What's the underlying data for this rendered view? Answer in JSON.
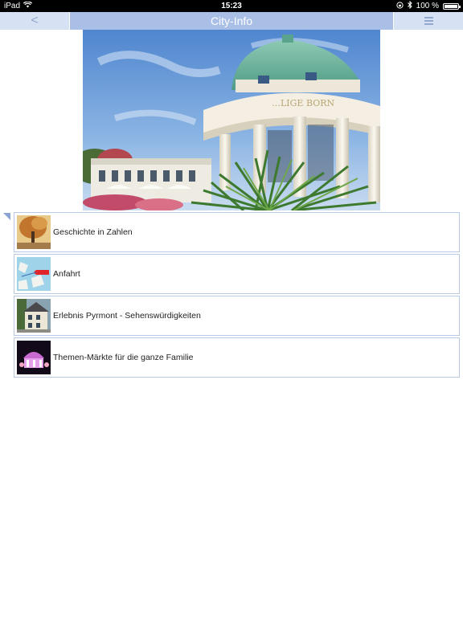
{
  "status_bar": {
    "device": "iPad",
    "time": "15:23",
    "battery": "100 %"
  },
  "nav": {
    "back_label": "<",
    "title": "City-Info"
  },
  "hero": {
    "sign_text": "…LIGE BORN"
  },
  "list": {
    "items": [
      {
        "label": "Geschichte in Zahlen"
      },
      {
        "label": "Anfahrt"
      },
      {
        "label": "Erlebnis Pyrmont - Sehenswürdigkeiten"
      },
      {
        "label": "Themen-Märkte für die ganze Familie"
      }
    ]
  },
  "colors": {
    "nav_title_bg": "#a9bfe6",
    "nav_side_bg": "#d6e1f3",
    "list_border": "#b9c8e3"
  }
}
